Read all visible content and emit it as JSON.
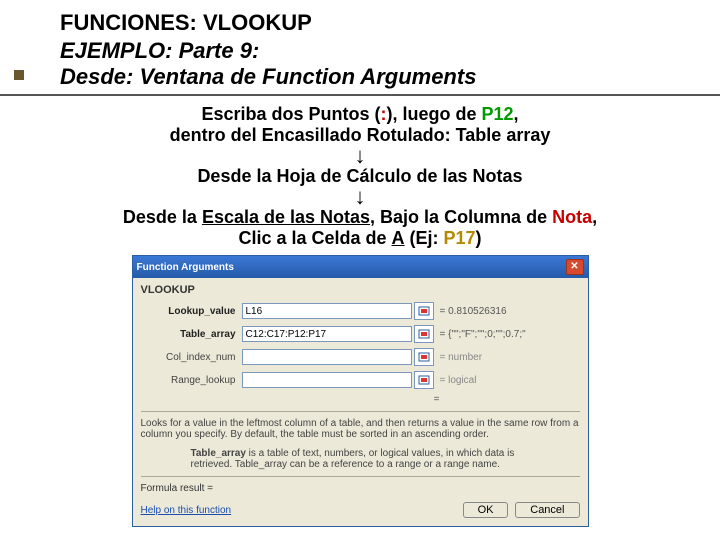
{
  "header": {
    "line1": "FUNCIONES: VLOOKUP",
    "line2_a": "EJEMPLO: Parte 9:",
    "line3_a": "Desde: Ventana de ",
    "line3_b": "Function Arguments"
  },
  "instr": {
    "l1_a": "Escriba dos Puntos (",
    "l1_b": ":",
    "l1_c": "), luego de ",
    "l1_d": "P12",
    "l1_e": ",",
    "l2_a": "dentro del Encasillado Rotulado: ",
    "l2_b": "Table array",
    "arrow1": "↓",
    "l3": "Desde la Hoja de Cálculo de las Notas",
    "arrow2": "↓",
    "l4_a": "Desde la ",
    "l4_b": "Escala de las Notas",
    "l4_c": ", Bajo la Columna de ",
    "l4_d": "Nota",
    "l4_e": ",",
    "l5_a": "Clic a  la Celda de ",
    "l5_b": "A",
    "l5_c": " (Ej: ",
    "l5_d": "P17",
    "l5_e": ")"
  },
  "dialog": {
    "title": "Function Arguments",
    "func": "VLOOKUP",
    "args": {
      "lookup_value": {
        "label": "Lookup_value",
        "value": "L16",
        "result": "= 0.810526316"
      },
      "table_array": {
        "label": "Table_array",
        "value": "C12:C17:P12:P17",
        "result": "= {\"\";\"F\";\"\";0;\"\";0.7;\""
      },
      "col_index_num": {
        "label": "Col_index_num",
        "value": "",
        "result_hint": "= number"
      },
      "range_lookup": {
        "label": "Range_lookup",
        "value": "",
        "result_hint": "= logical"
      }
    },
    "eq": "=",
    "desc": "Looks for a value in the leftmost column of a table, and then returns a value in the same row from a column you specify. By default, the table must be sorted in an ascending order.",
    "sub_label": "Table_array",
    "sub_desc": " is a table of text, numbers, or logical values, in which data is retrieved. Table_array can be a reference to a range or a range name.",
    "formula_result": "Formula result =",
    "help": "Help on this function",
    "ok": "OK",
    "cancel": "Cancel"
  }
}
